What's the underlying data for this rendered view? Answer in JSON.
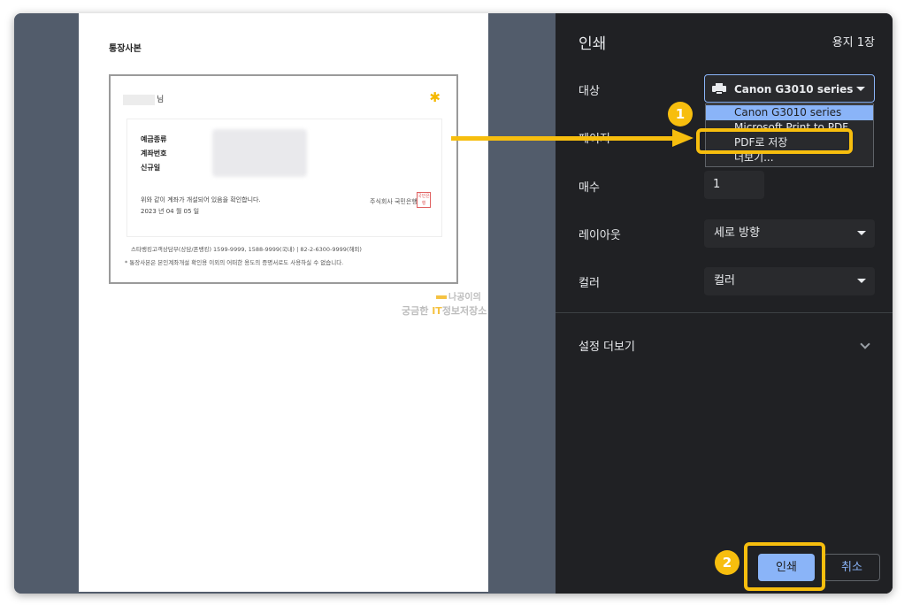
{
  "preview": {
    "doc_title": "통장사본",
    "account_suffix": "님",
    "fields": [
      "예금종류",
      "계좌번호",
      "신규일"
    ],
    "confirm_text": "위와 같이 계좌가 개설되어 있음을 확인합니다.",
    "date_text": "2023 년 04 월 05 일",
    "bank_stamp_text": "주식회사 국민은행",
    "stamp_seal": "국민은행",
    "contact_text": "스타뱅킹고객상담부(상담/폰뱅킹) 1599-9999, 1588-9999(국내) | 82-2-6300-9999(해외)",
    "note_text": "* 통장사본은 본인계좌개설 확인용 이외의 어떠한 용도의 증명서로도 사용하실 수 없습니다.",
    "watermark_line1": "나공이의",
    "watermark_line2_a": "궁금한 ",
    "watermark_line2_it": "IT",
    "watermark_line2_b": "정보저장소"
  },
  "print_panel": {
    "title": "인쇄",
    "sheet_count": "용지 1장",
    "destination_label": "대상",
    "destination_value": "Canon G3010 series",
    "destination_options": [
      {
        "label": "Canon G3010 series",
        "selected": true
      },
      {
        "label": "Microsoft Print to PDF",
        "selected": false
      },
      {
        "label": "PDF로 저장",
        "selected": false
      },
      {
        "label": "더보기...",
        "selected": false
      }
    ],
    "pages_label": "페이지",
    "copies_label": "매수",
    "copies_value": "1",
    "layout_label": "레이아웃",
    "layout_value": "세로 방향",
    "color_label": "컬러",
    "color_value": "컬러",
    "more_settings": "설정 더보기",
    "print_button": "인쇄",
    "cancel_button": "취소"
  },
  "annotations": {
    "step1": "1",
    "step2": "2",
    "highlight_color": "#f7be0e"
  }
}
